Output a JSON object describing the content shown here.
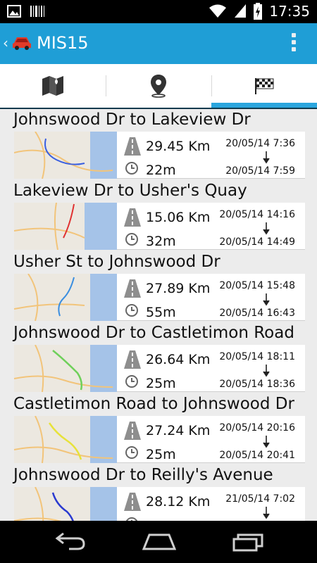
{
  "status_bar": {
    "time": "17:35"
  },
  "action_bar": {
    "title": "MIS15"
  },
  "tabs": [
    {
      "name": "map",
      "icon": "map-icon"
    },
    {
      "name": "location",
      "icon": "location-pin-icon"
    },
    {
      "name": "trips",
      "icon": "checkered-flag-icon",
      "selected": true
    }
  ],
  "colors": {
    "accent": "#1f9ed6",
    "indicator": "#2aa6de"
  },
  "trips": [
    {
      "title": "Johnswood Dr to Lakeview Dr",
      "distance": "29.45 Km",
      "duration": "22m",
      "start": "20/05/14 7:36",
      "end": "20/05/14 7:59"
    },
    {
      "title": "Lakeview Dr to Usher's Quay",
      "distance": "15.06 Km",
      "duration": "32m",
      "start": "20/05/14 14:16",
      "end": "20/05/14 14:49"
    },
    {
      "title": "Usher St to Johnswood Dr",
      "distance": "27.89 Km",
      "duration": "55m",
      "start": "20/05/14 15:48",
      "end": "20/05/14 16:43"
    },
    {
      "title": "Johnswood Dr to Castletimon Road",
      "distance": "26.64 Km",
      "duration": "25m",
      "start": "20/05/14 18:11",
      "end": "20/05/14 18:36"
    },
    {
      "title": "Castletimon Road to Johnswood Dr",
      "distance": "27.24 Km",
      "duration": "25m",
      "start": "20/05/14 20:16",
      "end": "20/05/14 20:41"
    },
    {
      "title": "Johnswood Dr to Reilly's Avenue",
      "distance": "28.12 Km",
      "duration": "",
      "start": "21/05/14 7:02",
      "end": ""
    }
  ]
}
